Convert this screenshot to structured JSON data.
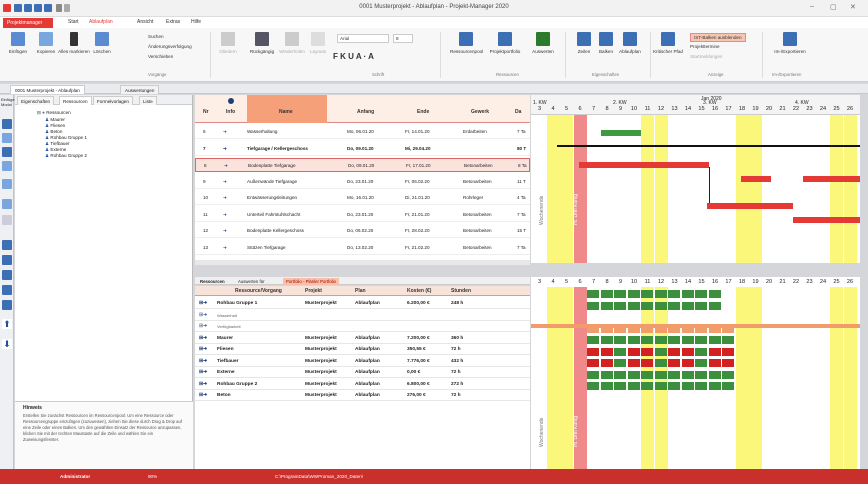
{
  "window": {
    "title": "0001 Musterprojekt - Ablaufplan - Projekt-Manager 2020"
  },
  "tabs": {
    "pm": "Projektmanager",
    "start": "Start",
    "ablauf": "Ablaufplan",
    "ansicht": "Ansicht",
    "extras": "Extras",
    "hilfe": "Hilfe"
  },
  "ribbon": {
    "einfuegen": "Einfügen",
    "kopieren": "Kopieren",
    "alles_markieren": "Alles markieren",
    "loeschen": "Löschen",
    "suchen": "Suchen",
    "aenderung": "Änderungsverfolgung",
    "verschieben": "Verschieben",
    "vorgaenge": "Vorgänge",
    "gliedern": "Gliedern",
    "rueckgaengig": "Rückgängig",
    "wiederholen": "Wiederholen",
    "layouts": "Layouts",
    "font": "Arial",
    "fontsize": "8",
    "schrift": "Schrift",
    "ressourcenpool": "Ressourcenpool",
    "projektportfolio": "Projektportfolio",
    "auswerten": "Auswerten",
    "ressourcen": "Ressourcen",
    "zeilen": "Zeilen",
    "balken": "Balken",
    "ablaufplan": "Ablaufplan",
    "eigenschaften": "Eigenschaften",
    "kritischer_pfad": "Kritischer Pfad",
    "ist_balken": "IST-Balken ausblenden",
    "projekttermine": "Projekttermine",
    "startmeldungen": "Startmeldungen",
    "anzeige": "Anzeige",
    "im_export": "Im-/Exportieren",
    "im_export_grp": "Im-/Exportieren"
  },
  "doctabs": {
    "first": "0001 Musterprojekt - Ablaufplan",
    "second": "Auswertungen"
  },
  "left": {
    "strip_label": "Einfüge Modul",
    "tabs": [
      "Eigenschaften",
      "Ressourcen",
      "Formelvorlagen",
      "Liste"
    ],
    "tree": [
      "Ressourcen",
      "Maurer",
      "Fliesen",
      "Beton",
      "Rohbau Gruppe 1",
      "Tiefbauer",
      "Externe",
      "Rohbau Gruppe 2"
    ],
    "hint_title": "Hinweis",
    "hint_body": "Erstellen Sie zunächst Ressourcen im Ressourcenpool. Um eine Ressource oder Ressourcengruppe einzufügen (zuzuweisen), ziehen Sie diese durch Drag & Drop auf eine Zeile oder einen Balken. Um den gewählten Einsatz der Ressource anzupassen, klicken Sie mit der rechten Maustaste auf die Zeile und wählen Sie ein Zuweisungsfenster."
  },
  "table": {
    "headers": {
      "nr": "Nr",
      "info": "Info",
      "name": "Name",
      "anfang": "Anfang",
      "ende": "Ende",
      "gewerk": "Gewerk",
      "da": "Da"
    },
    "rows": [
      {
        "nr": "6",
        "name": "Wasserhaltung",
        "anfang": "Mo, 06.01.20",
        "ende": "Fr, 14.01.20",
        "gewerk": "Erdarbeiten",
        "da": "7 Ta"
      },
      {
        "nr": "7",
        "name": "Tiefgarage / Kellergeschoss",
        "anfang": "Do, 09.01.20",
        "ende": "Mi, 29.04.20",
        "gewerk": "",
        "da": "80 T"
      },
      {
        "nr": "8",
        "name": "Bodenplatte Tiefgarage",
        "anfang": "Do, 09.01.20",
        "ende": "Fr, 17.01.20",
        "gewerk": "Betonarbeiten",
        "da": "8 Ta"
      },
      {
        "nr": "9",
        "name": "Außenwände Tiefgarage",
        "anfang": "Do, 23.01.20",
        "ende": "Fr, 06.02.20",
        "gewerk": "Betonarbeiten",
        "da": "11 T"
      },
      {
        "nr": "10",
        "name": "Entwässerungsleitungen",
        "anfang": "Mo, 16.01.20",
        "ende": "Di, 21.01.20",
        "gewerk": "Rohrleger",
        "da": "4 Ta"
      },
      {
        "nr": "11",
        "name": "Unterteil Fahrstuhlschacht",
        "anfang": "Do, 23.01.20",
        "ende": "Fr, 21.01.20",
        "gewerk": "Betonarbeiten",
        "da": "7 Ta"
      },
      {
        "nr": "12",
        "name": "Bodenplatte Kellergeschoss",
        "anfang": "Do, 06.02.20",
        "ende": "Fr, 28.02.20",
        "gewerk": "Betonarbeiten",
        "da": "15 T"
      },
      {
        "nr": "13",
        "name": "Stützen Tiefgarage",
        "anfang": "Do, 13.02.20",
        "ende": "Fr, 21.02.20",
        "gewerk": "Betonarbeiten",
        "da": "7 Ta"
      }
    ]
  },
  "gantt": {
    "month": "Jan 2020",
    "weeks": [
      "1. KW",
      "2. KW",
      "3. KW",
      "4. KW"
    ],
    "days": [
      "3",
      "4",
      "5",
      "6",
      "7",
      "8",
      "9",
      "10",
      "11",
      "12",
      "13",
      "14",
      "15",
      "16",
      "17",
      "18",
      "19",
      "20",
      "21",
      "22",
      "23",
      "24",
      "25",
      "26"
    ],
    "label_wochenende": "Wochenende",
    "label_feiertag": "Hl. Drei König"
  },
  "lower": {
    "tab1": "Ressourcen",
    "tab2": "Auswerten für",
    "tab3": "Portfolio - Planler Portfolio",
    "headers": {
      "res": "Ressource/Vorgang",
      "projekt": "Projekt",
      "plan": "Plan",
      "kosten": "Kosten (€)",
      "stunden": "Stunden"
    },
    "rows": [
      {
        "name": "Rohbau Gruppe 1",
        "projekt": "Musterprojekt",
        "plan": "Ablaufplan",
        "kosten": "6.200,00 €",
        "stunden": "248 h",
        "bold": true
      },
      {
        "name": "Wasserhalt",
        "projekt": "",
        "plan": "",
        "kosten": "",
        "stunden": "",
        "bold": false
      },
      {
        "name": "Verfügbarkeit",
        "projekt": "",
        "plan": "",
        "kosten": "",
        "stunden": "",
        "bold": false
      },
      {
        "name": "Maurer",
        "projekt": "Musterprojekt",
        "plan": "Ablaufplan",
        "kosten": "7.200,00 €",
        "stunden": "360 h",
        "bold": true
      },
      {
        "name": "Fliesen",
        "projekt": "Musterprojekt",
        "plan": "Ablaufplan",
        "kosten": "350,55 €",
        "stunden": "72 h",
        "bold": true
      },
      {
        "name": "Tiefbauer",
        "projekt": "Musterprojekt",
        "plan": "Ablaufplan",
        "kosten": "7.776,00 €",
        "stunden": "432 h",
        "bold": true
      },
      {
        "name": "Externe",
        "projekt": "Musterprojekt",
        "plan": "Ablaufplan",
        "kosten": "0,00 €",
        "stunden": "72 h",
        "bold": true
      },
      {
        "name": "Rohbau Gruppe 2",
        "projekt": "Musterprojekt",
        "plan": "Ablaufplan",
        "kosten": "6.800,00 €",
        "stunden": "272 h",
        "bold": true
      },
      {
        "name": "Beton",
        "projekt": "Musterprojekt",
        "plan": "Ablaufplan",
        "kosten": "276,00 €",
        "stunden": "72 h",
        "bold": true
      }
    ]
  },
  "status": {
    "left": "Administrator",
    "zoom": "90%",
    "path": "C:\\ProgramData\\WWProman_2020_Daten\\"
  },
  "colors": {
    "accent": "#e53935",
    "weekend": "#fbf77a",
    "holiday": "#f08a8a",
    "gantt_bar": "#e53935",
    "load_green": "#3c8f3c",
    "load_red": "#d32020"
  }
}
